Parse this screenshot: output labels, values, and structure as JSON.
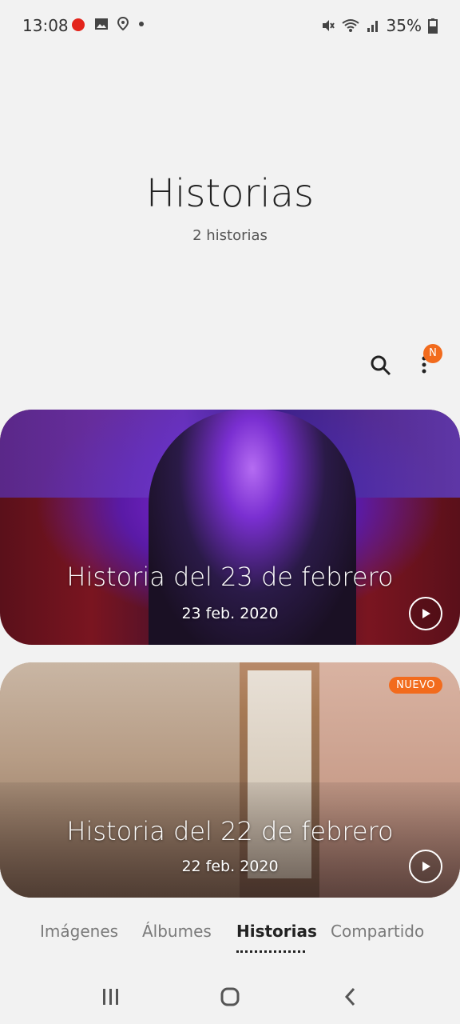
{
  "status_bar": {
    "time": "13:08",
    "battery": "35%",
    "left_icons": [
      "fire-app-icon",
      "image-icon",
      "location-icon",
      "dot-icon"
    ],
    "right_icons": [
      "mute-icon",
      "wifi-icon",
      "signal-icon",
      "battery-icon"
    ]
  },
  "header": {
    "title": "Historias",
    "subtitle": "2 historias"
  },
  "toolbar": {
    "search_icon": "search-icon",
    "more_icon": "more-vertical-icon",
    "notification_badge": "N",
    "badge_color": "#f26b1d"
  },
  "stories": [
    {
      "title": "Historia del 23 de febrero",
      "date": "23 feb. 2020",
      "play_icon": "play-icon"
    },
    {
      "title": "Historia del 22 de febrero",
      "date": "22 feb. 2020",
      "badge": "NUEVO",
      "play_icon": "play-icon"
    }
  ],
  "tabs": [
    {
      "label": "Imágenes"
    },
    {
      "label": "Álbumes"
    },
    {
      "label": "Historias"
    },
    {
      "label": "Compartido"
    }
  ],
  "nav": {
    "recent_icon": "recent-apps-icon",
    "home_icon": "home-icon",
    "back_icon": "back-icon"
  }
}
